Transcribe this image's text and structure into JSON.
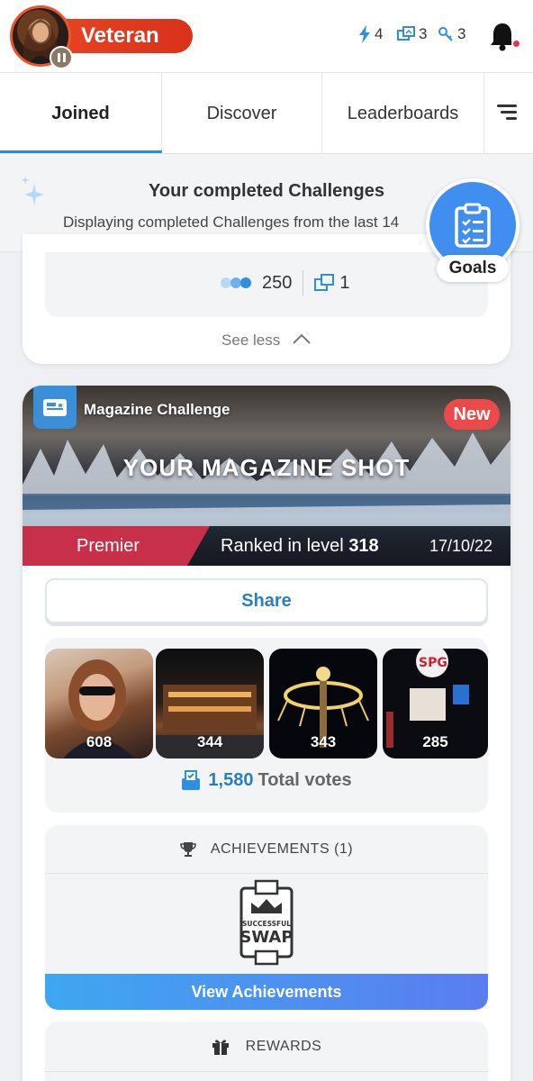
{
  "header": {
    "rank": "Veteran",
    "energy": "4",
    "swaps": "3",
    "keys": "3"
  },
  "tabs": [
    {
      "label": "Joined",
      "active": true
    },
    {
      "label": "Discover",
      "active": false
    },
    {
      "label": "Leaderboards",
      "active": false
    }
  ],
  "banner": {
    "title": "Your completed Challenges",
    "subtitle": "Displaying completed Challenges from the last 14"
  },
  "goals": {
    "label": "Goals"
  },
  "prev_card": {
    "votes": "250",
    "swaps": "1",
    "see_less": "See less"
  },
  "challenge": {
    "type": "Magazine Challenge",
    "badge": "New",
    "title": "YOUR MAGAZINE SHOT",
    "level_name": "Premier",
    "ranked_prefix": "Ranked in level",
    "ranked_level": "318",
    "date": "17/10/22",
    "share": "Share",
    "photos": [
      {
        "votes": "608"
      },
      {
        "votes": "344"
      },
      {
        "votes": "343"
      },
      {
        "votes": "285"
      }
    ],
    "total_votes": "1,580",
    "total_votes_label": "Total votes",
    "achievements_title": "ACHIEVEMENTS (1)",
    "achievement_badge_line1": "SUCCESSFUL",
    "achievement_badge_line2": "SWAP",
    "view_achievements": "View Achievements",
    "rewards_title": "REWARDS"
  },
  "colors": {
    "accent_blue": "#2a7fc1",
    "rank_red": "#e64322",
    "premier_red": "#c8304a",
    "new_red": "#ec4a4a"
  }
}
